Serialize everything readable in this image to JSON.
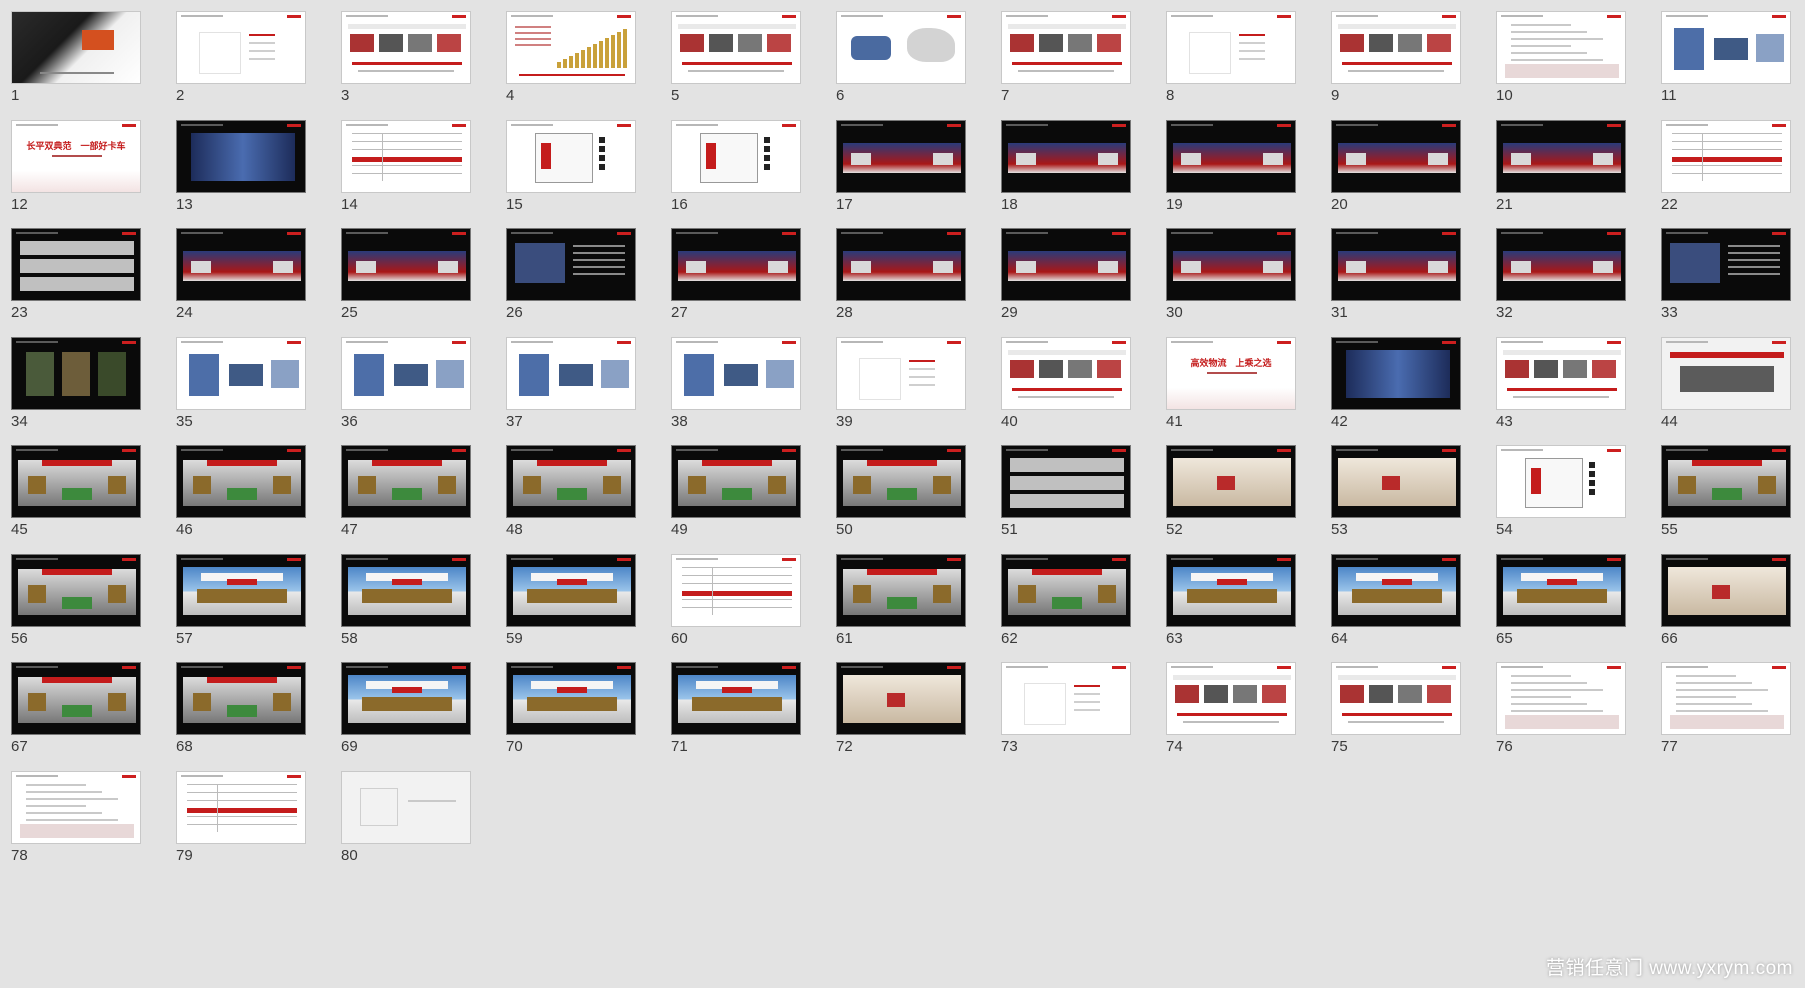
{
  "slides": [
    {
      "num": "1",
      "style": "cover"
    },
    {
      "num": "2",
      "style": "outline"
    },
    {
      "num": "3",
      "style": "content"
    },
    {
      "num": "4",
      "style": "bars"
    },
    {
      "num": "5",
      "style": "content"
    },
    {
      "num": "6",
      "style": "map"
    },
    {
      "num": "7",
      "style": "content"
    },
    {
      "num": "8",
      "style": "outline"
    },
    {
      "num": "9",
      "style": "content"
    },
    {
      "num": "10",
      "style": "list"
    },
    {
      "num": "11",
      "style": "photo"
    },
    {
      "num": "12",
      "style": "title",
      "title": "长平双典范　一部好卡车"
    },
    {
      "num": "13",
      "style": "banner"
    },
    {
      "num": "14",
      "style": "table"
    },
    {
      "num": "15",
      "style": "plan"
    },
    {
      "num": "16",
      "style": "plan"
    },
    {
      "num": "17",
      "style": "stage"
    },
    {
      "num": "18",
      "style": "stage"
    },
    {
      "num": "19",
      "style": "stage"
    },
    {
      "num": "20",
      "style": "stage"
    },
    {
      "num": "21",
      "style": "stage"
    },
    {
      "num": "22",
      "style": "table"
    },
    {
      "num": "23",
      "style": "darkgrid"
    },
    {
      "num": "24",
      "style": "stage"
    },
    {
      "num": "25",
      "style": "stage"
    },
    {
      "num": "26",
      "style": "darktext"
    },
    {
      "num": "27",
      "style": "stage"
    },
    {
      "num": "28",
      "style": "stage"
    },
    {
      "num": "29",
      "style": "stage"
    },
    {
      "num": "30",
      "style": "stage"
    },
    {
      "num": "31",
      "style": "stage"
    },
    {
      "num": "32",
      "style": "stage"
    },
    {
      "num": "33",
      "style": "darktext"
    },
    {
      "num": "34",
      "style": "darkphoto"
    },
    {
      "num": "35",
      "style": "photo"
    },
    {
      "num": "36",
      "style": "photo"
    },
    {
      "num": "37",
      "style": "photo"
    },
    {
      "num": "38",
      "style": "photo"
    },
    {
      "num": "39",
      "style": "outline"
    },
    {
      "num": "40",
      "style": "content"
    },
    {
      "num": "41",
      "style": "title",
      "title": "高效物流　上乘之选"
    },
    {
      "num": "42",
      "style": "banner"
    },
    {
      "num": "43",
      "style": "content"
    },
    {
      "num": "44",
      "style": "grey"
    },
    {
      "num": "45",
      "style": "booth"
    },
    {
      "num": "46",
      "style": "booth"
    },
    {
      "num": "47",
      "style": "booth"
    },
    {
      "num": "48",
      "style": "booth"
    },
    {
      "num": "49",
      "style": "booth"
    },
    {
      "num": "50",
      "style": "booth"
    },
    {
      "num": "51",
      "style": "darkgrid"
    },
    {
      "num": "52",
      "style": "room"
    },
    {
      "num": "53",
      "style": "room"
    },
    {
      "num": "54",
      "style": "plan"
    },
    {
      "num": "55",
      "style": "booth"
    },
    {
      "num": "56",
      "style": "booth"
    },
    {
      "num": "57",
      "style": "sky"
    },
    {
      "num": "58",
      "style": "sky"
    },
    {
      "num": "59",
      "style": "sky"
    },
    {
      "num": "60",
      "style": "table"
    },
    {
      "num": "61",
      "style": "booth"
    },
    {
      "num": "62",
      "style": "booth"
    },
    {
      "num": "63",
      "style": "sky"
    },
    {
      "num": "64",
      "style": "sky"
    },
    {
      "num": "65",
      "style": "sky"
    },
    {
      "num": "66",
      "style": "room"
    },
    {
      "num": "67",
      "style": "booth"
    },
    {
      "num": "68",
      "style": "booth"
    },
    {
      "num": "69",
      "style": "sky"
    },
    {
      "num": "70",
      "style": "sky"
    },
    {
      "num": "71",
      "style": "sky"
    },
    {
      "num": "72",
      "style": "room"
    },
    {
      "num": "73",
      "style": "outline"
    },
    {
      "num": "74",
      "style": "content"
    },
    {
      "num": "75",
      "style": "content"
    },
    {
      "num": "76",
      "style": "list"
    },
    {
      "num": "77",
      "style": "list"
    },
    {
      "num": "78",
      "style": "list"
    },
    {
      "num": "79",
      "style": "table"
    },
    {
      "num": "80",
      "style": "end"
    }
  ],
  "watermark": "营销任意门 www.yxrym.com",
  "colors": {
    "background": "#e3e3e3",
    "accent": "#c41c1c",
    "number": "#3a3a3a"
  }
}
